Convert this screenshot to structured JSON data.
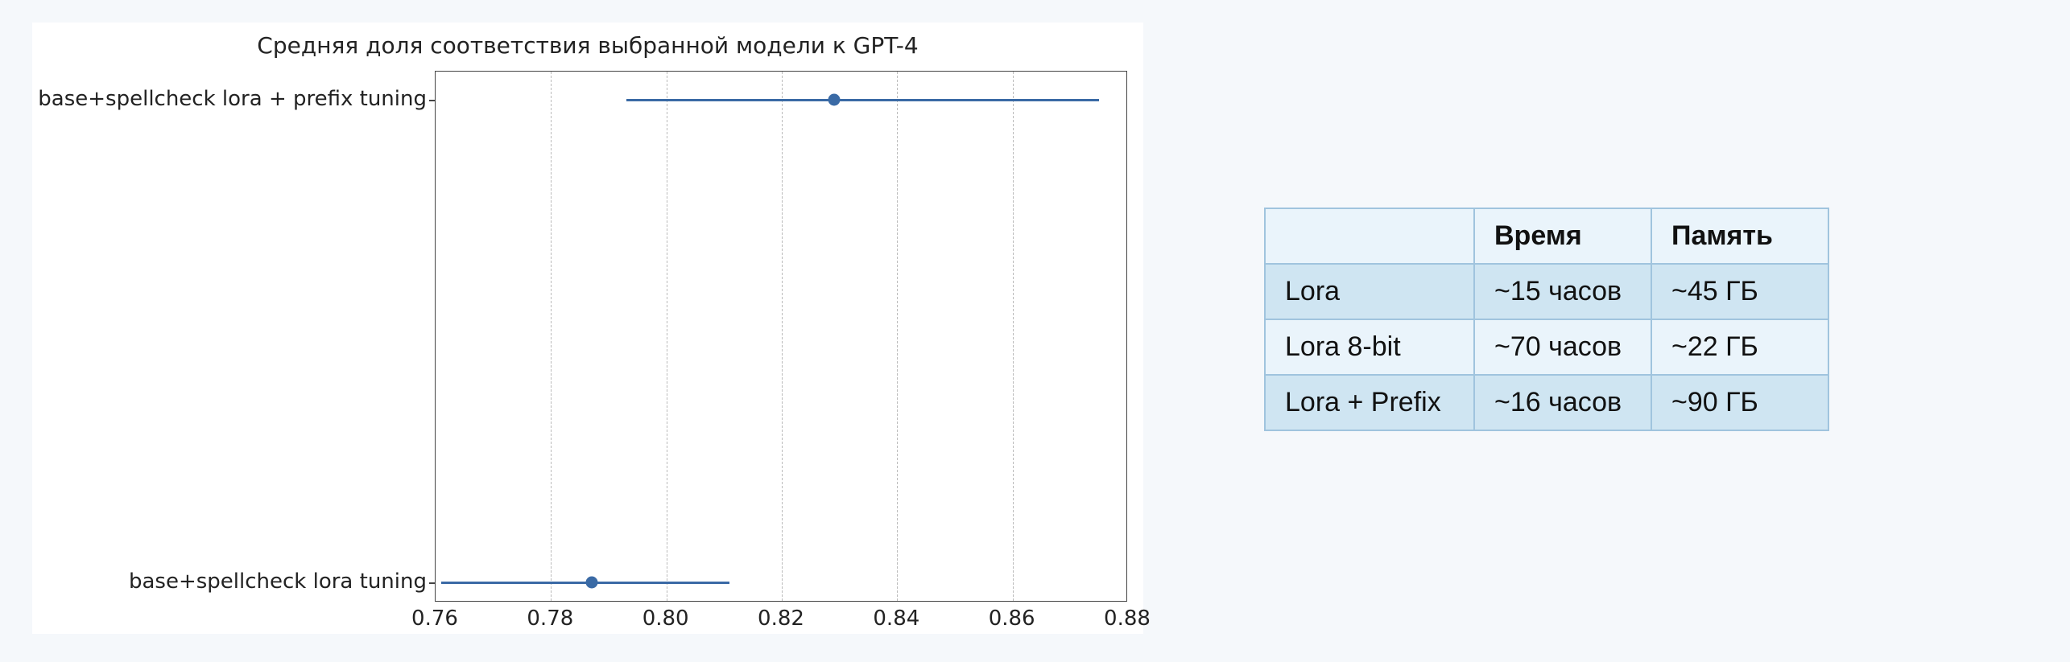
{
  "chart_data": {
    "type": "scatter",
    "title": "Средняя доля соответствия выбранной модели к GPT-4",
    "xlabel": "",
    "ylabel": "",
    "xlim": [
      0.76,
      0.88
    ],
    "xticks": [
      0.76,
      0.78,
      0.8,
      0.82,
      0.84,
      0.86,
      0.88
    ],
    "xtick_labels": [
      "0.76",
      "0.78",
      "0.80",
      "0.82",
      "0.84",
      "0.86",
      "0.88"
    ],
    "categories": [
      "base+spellcheck lora + prefix tuning",
      "base+spellcheck lora tuning"
    ],
    "series": [
      {
        "name": "base+spellcheck lora + prefix tuning",
        "value": 0.829,
        "err_low": 0.793,
        "err_high": 0.875
      },
      {
        "name": "base+spellcheck lora tuning",
        "value": 0.787,
        "err_low": 0.761,
        "err_high": 0.811
      }
    ]
  },
  "table": {
    "headers": [
      "",
      "Время",
      "Память"
    ],
    "rows": [
      {
        "name": "Lora",
        "time": "~15 часов",
        "memory": "~45 ГБ"
      },
      {
        "name": "Lora 8-bit",
        "time": "~70 часов",
        "memory": "~22 ГБ"
      },
      {
        "name": "Lora + Prefix",
        "time": "~16 часов",
        "memory": "~90 ГБ"
      }
    ]
  }
}
